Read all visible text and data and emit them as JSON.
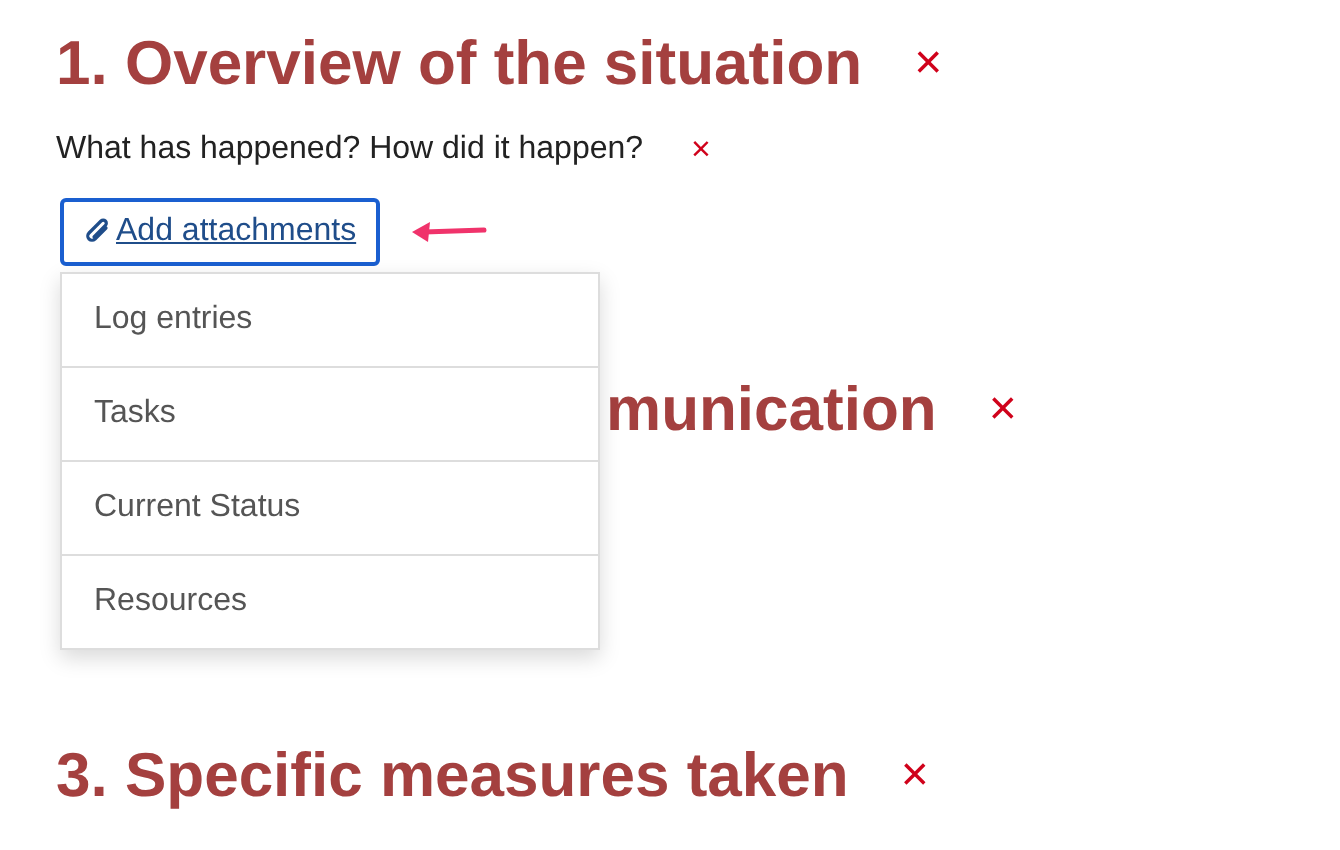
{
  "sections": [
    {
      "heading": "1. Overview of the situation",
      "remove": "×",
      "prompt": "What has happened? How did it happen?",
      "prompt_remove": "×",
      "attach_button": "Add attachments",
      "menu": {
        "items": [
          {
            "label": "Log entries"
          },
          {
            "label": "Tasks"
          },
          {
            "label": "Current Status"
          },
          {
            "label": "Resources"
          }
        ]
      }
    },
    {
      "heading": "munication",
      "remove": "×"
    },
    {
      "heading": "3. Specific measures taken",
      "remove": "×"
    }
  ]
}
